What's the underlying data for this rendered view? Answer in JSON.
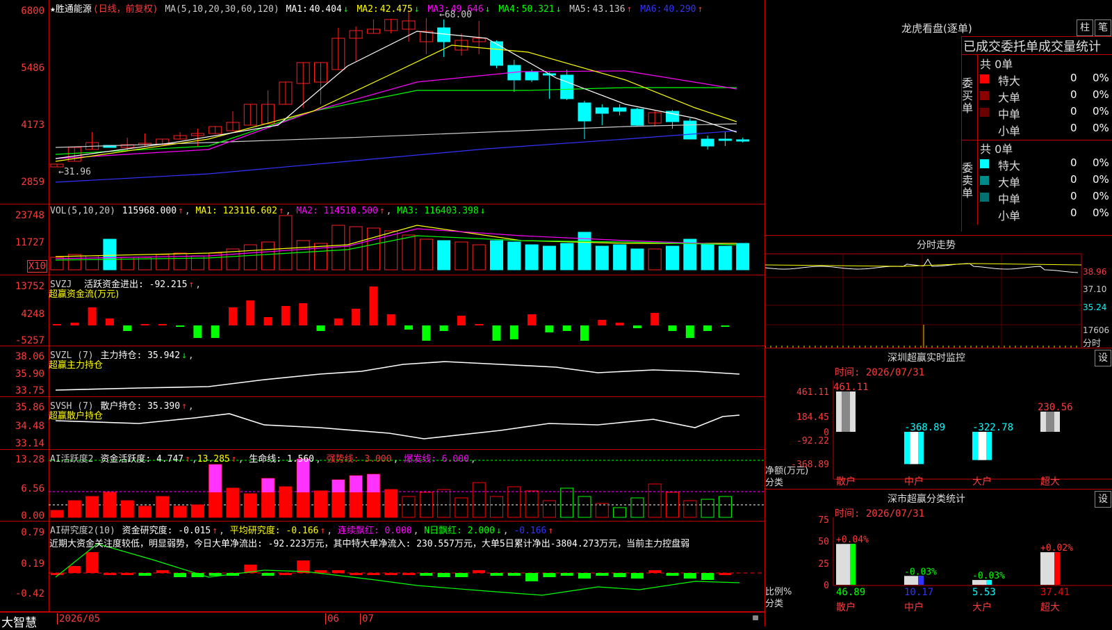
{
  "stock": {
    "name": "★胜通能源",
    "mode": "(日线，前复权)",
    "ma_title": "MA(5,10,20,30,60,120)",
    "ma": [
      {
        "label": "MA1:",
        "value": "40.404",
        "arrow": "↓",
        "color": "#ffffff"
      },
      {
        "label": "MA2:",
        "value": "42.475",
        "arrow": "↓",
        "color": "#ffff00"
      },
      {
        "label": "MA3:",
        "value": "49.646",
        "arrow": "↓",
        "color": "#ff00ff"
      },
      {
        "label": "MA4:",
        "value": "50.321",
        "arrow": "↓",
        "color": "#00ff00"
      },
      {
        "label": "MA5:",
        "value": "43.136",
        "arrow": "↑",
        "color": "#cccccc"
      },
      {
        "label": "MA6:",
        "value": "40.290",
        "arrow": "↑",
        "color": "#3333ff"
      }
    ],
    "price_ticks": [
      "6800",
      "5486",
      "4173",
      "2859"
    ],
    "high_label": "68.00",
    "low_label": "31.96"
  },
  "vol": {
    "title": "VOL(5,10,20)",
    "value": "115968.000",
    "ma1": "MA1: 123116.602",
    "ma2": "MA2: 114510.500",
    "ma3": "MA3: 116403.398",
    "ticks": [
      "23748",
      "11727"
    ],
    "unit": "X10"
  },
  "svzj": {
    "title": "SVZJ",
    "name": "活跃资金进出: -92.215",
    "sub": "超赢资金流(万元)",
    "ticks": [
      "13752",
      "4248",
      "-5257"
    ]
  },
  "svzl": {
    "title": "SVZL (7)",
    "name": "主力持仓: 35.942",
    "sub": "超赢主力持仓",
    "ticks": [
      "38.06",
      "35.90",
      "33.75"
    ]
  },
  "svsh": {
    "title": "SVSH (7)",
    "name": "散户持仓: 35.390",
    "sub": "超赢散户持仓",
    "ticks": [
      "35.86",
      "34.48",
      "33.14"
    ]
  },
  "ai2": {
    "title": "AI活跃度2",
    "name": "资金活跃度: 4.747",
    "v2": "13.285",
    "life": "生命线: 1.560",
    "strong": "强势线: 3.000",
    "burst": "爆发线: 6.000",
    "ticks": [
      "13.28",
      "6.56",
      "0.00"
    ]
  },
  "ai_research": {
    "title": "AI研究度2(10)",
    "name": "资金研究度: -0.015",
    "avg": "平均研究度: -0.166",
    "red": "连续飘红: 0.000",
    "nred": "N日飘红: 2.000",
    "last": "-0.166",
    "comment": "近期大资金关注度较低，明显弱势，今日大单净流出: -92.223万元，其中特大单净流入: 230.557万元，大单5日累计净出-3804.273万元，当前主力控盘弱",
    "ticks": [
      "0.79",
      "0.19",
      "-0.42"
    ]
  },
  "bottom": {
    "logo": "大智慧",
    "dates": [
      "2026/05",
      "06",
      "07"
    ]
  },
  "right": {
    "header_title": "龙虎看盘(逐单)",
    "btn_zhu": "柱",
    "btn_bi": "笔",
    "section_title": "已成交委托单成交量统计",
    "buy_label": "委买单",
    "buy_total": "共 0单",
    "sell_label": "委卖单",
    "sell_total": "共 0单",
    "buy_rows": [
      {
        "name": "特大",
        "count": "0",
        "pct": "0%",
        "color": "#ff0000"
      },
      {
        "name": "大单",
        "count": "0",
        "pct": "0%",
        "color": "#8b0000"
      },
      {
        "name": "中单",
        "count": "0",
        "pct": "0%",
        "color": "#6b0000"
      },
      {
        "name": "小单",
        "count": "0",
        "pct": "0%",
        "color": "#000000"
      }
    ],
    "sell_rows": [
      {
        "name": "特大",
        "count": "0",
        "pct": "0%",
        "color": "#00ffff"
      },
      {
        "name": "大单",
        "count": "0",
        "pct": "0%",
        "color": "#008b8b"
      },
      {
        "name": "中单",
        "count": "0",
        "pct": "0%",
        "color": "#007070"
      },
      {
        "name": "小单",
        "count": "0",
        "pct": "0%",
        "color": "#000000"
      }
    ],
    "intraday_title": "分时走势",
    "intraday_ticks": [
      "38.96",
      "37.10",
      "35.24",
      "17606"
    ],
    "intraday_unit": "分时",
    "sz_title": "深圳超赢实时监控",
    "sz_btn": "设",
    "sz_time": "时间: 2026/07/31",
    "sz_ticks": [
      "461.11",
      "184.45",
      "0",
      "-92.22",
      "-368.89"
    ],
    "sz_bars": [
      {
        "cat": "散户",
        "val": 461.11,
        "label": "461.11"
      },
      {
        "cat": "中户",
        "val": -368.89,
        "label": "-368.89"
      },
      {
        "cat": "大户",
        "val": -322.78,
        "label": "-322.78"
      },
      {
        "cat": "超大",
        "val": 230.56,
        "label": "230.56"
      }
    ],
    "sz_ylabel": "净额(万元)",
    "sz_xlabel": "分类",
    "sc_title": "深市超赢分类统计",
    "sc_btn": "设",
    "sc_time": "时间: 2026/07/31",
    "sc_ticks": [
      "75",
      "50",
      "25",
      "0"
    ],
    "sc_bars": [
      {
        "cat": "散户",
        "val": 46.89,
        "label": "46.89",
        "chg": "+0.04%",
        "color": "#00ff00"
      },
      {
        "cat": "中户",
        "val": 10.17,
        "label": "10.17",
        "chg": "-0.03%",
        "color": "#3333ff"
      },
      {
        "cat": "大户",
        "val": 5.53,
        "label": "5.53",
        "chg": "-0.03%",
        "color": "#00ffff"
      },
      {
        "cat": "超大",
        "val": 37.41,
        "label": "37.41",
        "chg": "+0.02%",
        "color": "#ff0000"
      }
    ],
    "sc_ylabel": "比例%",
    "sc_xlabel": "分类"
  },
  "colors": {
    "up": "#ff2020",
    "down": "#00ffff",
    "grid": "#c00000",
    "text_red": "#ff3b3b"
  }
}
